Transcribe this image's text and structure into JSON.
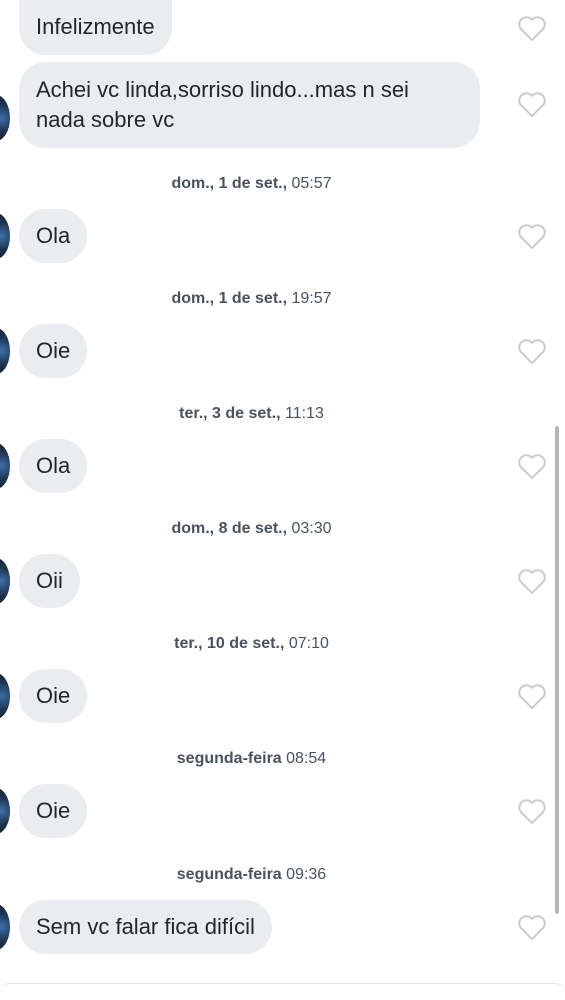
{
  "messages": [
    {
      "text": "Infelizmente"
    },
    {
      "text": "Achei vc linda,sorriso lindo...mas n sei nada sobre vc"
    },
    {
      "text": "Ola"
    },
    {
      "text": "Oie"
    },
    {
      "text": "Ola"
    },
    {
      "text": "Oii"
    },
    {
      "text": "Oie"
    },
    {
      "text": "Oie"
    },
    {
      "text": "Sem vc falar fica difícil"
    }
  ],
  "timestamps": [
    {
      "day": "dom., 1 de set.,",
      "time": "05:57"
    },
    {
      "day": "dom., 1 de set.,",
      "time": "19:57"
    },
    {
      "day": "ter., 3 de set.,",
      "time": "11:13"
    },
    {
      "day": "dom., 8 de set.,",
      "time": "03:30"
    },
    {
      "day": "ter., 10 de set.,",
      "time": "07:10"
    },
    {
      "day": "segunda-feira",
      "time": "08:54"
    },
    {
      "day": "segunda-feira",
      "time": "09:36"
    }
  ],
  "icons": {
    "like": "heart-outline-icon"
  },
  "colors": {
    "bubble": "#ebecf0",
    "text": "#21262e",
    "heart": "#c9ccd1"
  }
}
